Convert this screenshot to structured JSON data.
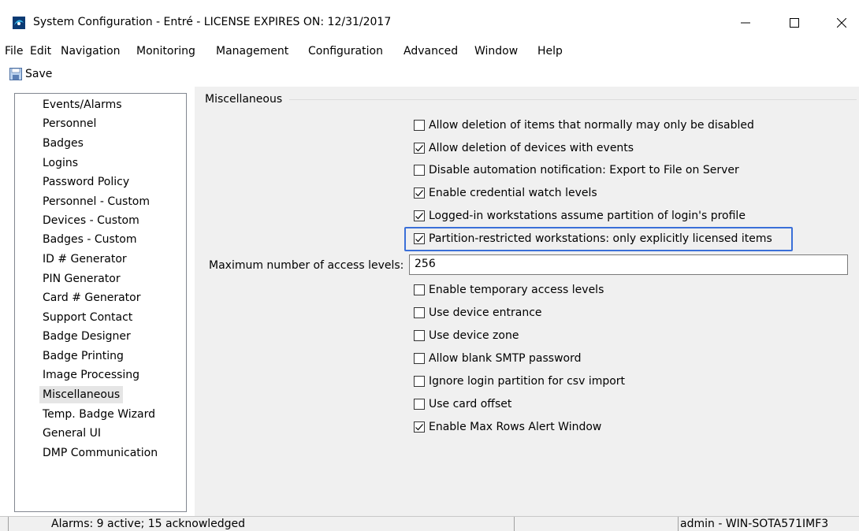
{
  "window": {
    "title": "System Configuration - Entré - LICENSE EXPIRES ON: 12/31/2017",
    "icon": "app-logo-icon",
    "controls": [
      "minimize-icon",
      "maximize-icon",
      "close-icon"
    ]
  },
  "menu": {
    "items": [
      "File",
      "Edit",
      "Navigation",
      "Monitoring",
      "Management",
      "Configuration",
      "Advanced",
      "Window",
      "Help"
    ]
  },
  "toolbar": {
    "save_label": "Save",
    "save_icon": "floppy-disk-icon"
  },
  "sidebar": {
    "selected": "Miscellaneous",
    "items": [
      "Events/Alarms",
      "Personnel",
      "Badges",
      "Logins",
      "Password Policy",
      "Personnel - Custom",
      "Devices - Custom",
      "Badges - Custom",
      "ID # Generator",
      "PIN Generator",
      "Card # Generator",
      "Support Contact",
      "Badge Designer",
      "Badge Printing",
      "Image Processing",
      "Miscellaneous",
      "Temp. Badge Wizard",
      "General UI",
      "DMP Communication"
    ]
  },
  "misc": {
    "group_title": "Miscellaneous",
    "options_top": [
      {
        "label": "Allow deletion of items that normally may only be disabled",
        "checked": false
      },
      {
        "label": "Allow deletion of devices with events",
        "checked": true
      },
      {
        "label": "Disable automation notification: Export to File on Server",
        "checked": false
      },
      {
        "label": "Enable credential watch levels",
        "checked": true
      },
      {
        "label": "Logged-in workstations assume partition of login's profile",
        "checked": true
      },
      {
        "label": "Partition-restricted workstations: only explicitly licensed items",
        "checked": true
      }
    ],
    "max_access_levels_label": "Maximum number of access levels:",
    "max_access_levels_value": "256",
    "options_bottom": [
      {
        "label": "Enable temporary access levels",
        "checked": false
      },
      {
        "label": "Use device entrance",
        "checked": false
      },
      {
        "label": "Use device zone",
        "checked": false
      },
      {
        "label": "Allow blank SMTP password",
        "checked": false
      },
      {
        "label": "Ignore login partition for csv import",
        "checked": false
      },
      {
        "label": "Use card offset",
        "checked": false
      },
      {
        "label": "Enable Max Rows Alert Window",
        "checked": true
      }
    ],
    "highlight_color": "#3a6fd8"
  },
  "status": {
    "alarms": "Alarms: 9 active; 15 acknowledged",
    "user": "admin - WIN-SOTA571IMF3"
  }
}
